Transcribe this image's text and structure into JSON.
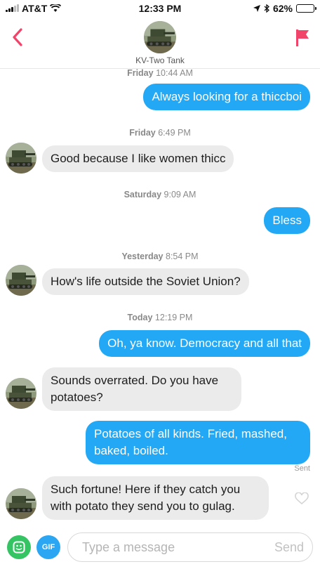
{
  "status_bar": {
    "carrier": "AT&T",
    "time": "12:33 PM",
    "battery": "62%",
    "battery_level": 0.62
  },
  "header": {
    "contact_name": "KV-Two Tank",
    "back_icon": "chevron-left-icon",
    "flag_icon": "flag-icon",
    "accent_color": "#f0446a"
  },
  "messages": [
    {
      "type": "timestamp",
      "day": "Friday",
      "time": "10:44 AM"
    },
    {
      "type": "outgoing",
      "text": "Always looking for a thiccboi"
    },
    {
      "type": "timestamp",
      "day": "Friday",
      "time": "6:49 PM"
    },
    {
      "type": "incoming",
      "text": "Good because I like women thicc"
    },
    {
      "type": "timestamp",
      "day": "Saturday",
      "time": "9:09 AM"
    },
    {
      "type": "outgoing",
      "text": "Bless"
    },
    {
      "type": "timestamp",
      "day": "Yesterday",
      "time": "8:54 PM"
    },
    {
      "type": "incoming",
      "text": "How's life outside the Soviet Union?"
    },
    {
      "type": "timestamp",
      "day": "Today",
      "time": "12:19 PM"
    },
    {
      "type": "outgoing",
      "text": "Oh, ya know. Democracy and all that"
    },
    {
      "type": "incoming",
      "text": "Sounds overrated. Do you have potatoes?"
    },
    {
      "type": "outgoing",
      "text": "Potatoes of all kinds. Fried, mashed, baked, boiled."
    },
    {
      "type": "status",
      "text": "Sent"
    },
    {
      "type": "incoming",
      "text": "Such fortune! Here if they catch you with potato they send you to gulag."
    }
  ],
  "composer": {
    "placeholder": "Type a message",
    "send_label": "Send",
    "gif_label": "GIF",
    "sticker_color": "#35c464",
    "gif_color": "#2aa6f3"
  },
  "colors": {
    "outgoing_bubble": "#22a8f5",
    "incoming_bubble": "#ebebeb"
  }
}
